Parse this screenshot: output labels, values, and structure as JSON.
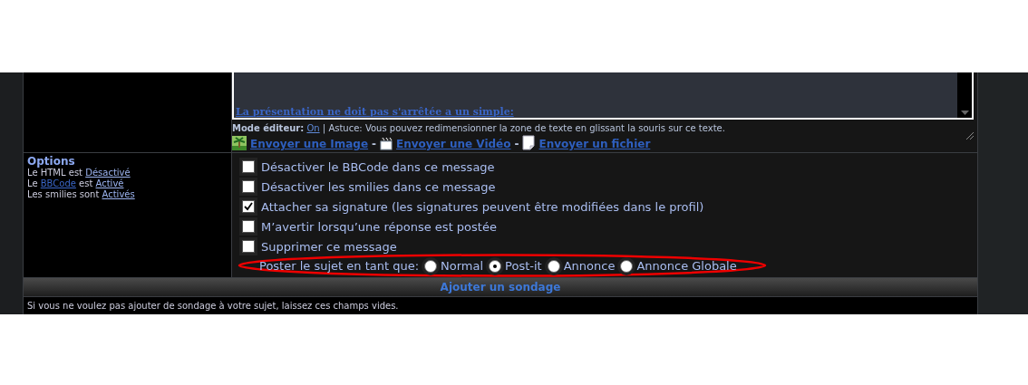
{
  "editor": {
    "text": "La présentation ne doit pas s'arrêtée a un simple:",
    "mode_label": "Mode éditeur:",
    "mode_value": "On",
    "tip": "| Astuce: Vous pouvez redimensionner la zone de texte en glissant la souris sur ce texte.",
    "uploads": [
      {
        "kind": "image",
        "label": "Envoyer une Image"
      },
      {
        "kind": "video",
        "label": "Envoyer une Vidéo"
      },
      {
        "kind": "file",
        "label": "Envoyer un fichier"
      }
    ],
    "separator": "-"
  },
  "options": {
    "title": "Options",
    "lines": [
      {
        "parts": [
          {
            "kind": "text",
            "text": "Le HTML est "
          },
          {
            "kind": "link",
            "text": "Désactivé"
          }
        ]
      },
      {
        "parts": [
          {
            "kind": "text",
            "text": "Le "
          },
          {
            "kind": "link",
            "text": "BBCode"
          },
          {
            "kind": "text",
            "text": " est "
          },
          {
            "kind": "link",
            "text": "Activé"
          }
        ]
      },
      {
        "parts": [
          {
            "kind": "text",
            "text": "Les smilies sont "
          },
          {
            "kind": "link",
            "text": "Activés"
          }
        ]
      }
    ],
    "checkboxes": [
      {
        "label": "Désactiver le BBCode dans ce message",
        "checked": false
      },
      {
        "label": "Désactiver les smilies dans ce message",
        "checked": false
      },
      {
        "label": "Attacher sa signature (les signatures peuvent être modifiées dans le profil)",
        "checked": true
      },
      {
        "label": "M’avertir lorsqu’une réponse est postée",
        "checked": false
      },
      {
        "label": "Supprimer ce message",
        "checked": false
      }
    ],
    "post_as": {
      "label": "Poster le sujet en tant que:",
      "choices": [
        {
          "label": "Normal",
          "selected": false
        },
        {
          "label": "Post-it",
          "selected": true
        },
        {
          "label": "Annonce",
          "selected": false
        },
        {
          "label": "Annonce Globale",
          "selected": false
        }
      ]
    }
  },
  "poll": {
    "header": "Ajouter un sondage",
    "hint": "Si vous ne voulez pas ajouter de sondage à votre sujet, laissez ces champs vides."
  }
}
